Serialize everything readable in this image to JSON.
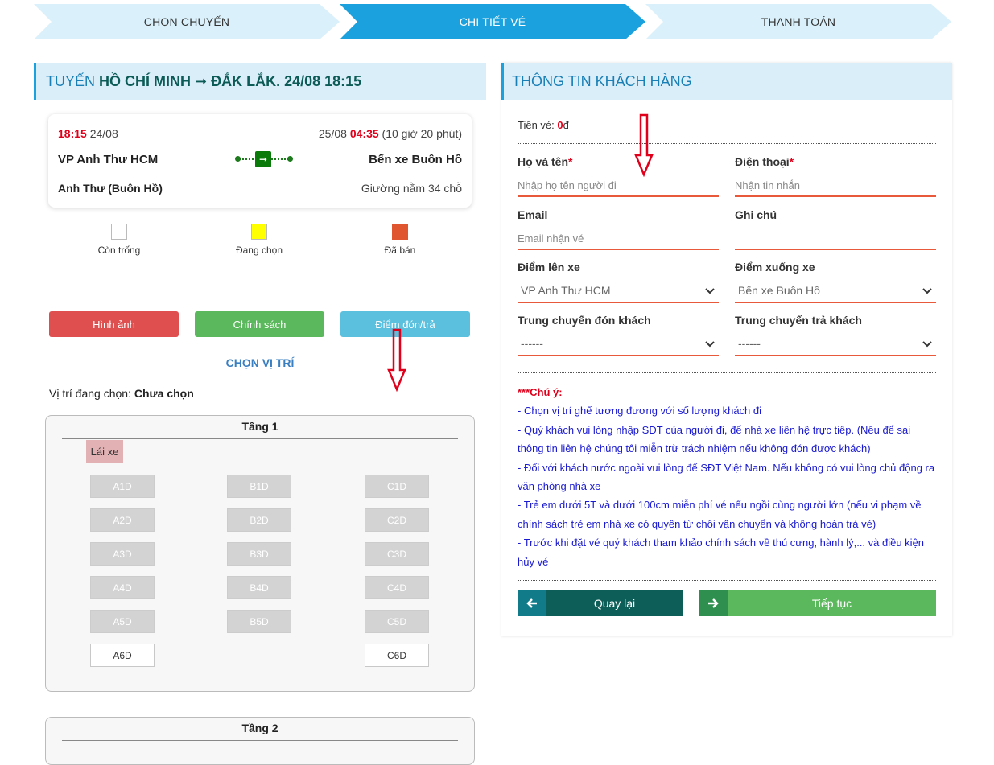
{
  "steps": [
    "CHỌN CHUYẾN",
    "CHI TIẾT VÉ",
    "THANH TOÁN"
  ],
  "route": {
    "prefix": "TUYẾN",
    "path": "HỒ CHÍ MINH ➞ ĐẮK LẮK",
    "datetime": ". 24/08 18:15"
  },
  "trip": {
    "dep_time": "18:15",
    "dep_date": "24/08",
    "arr_date": "25/08",
    "arr_time": "04:35",
    "duration": "(10 giờ 20 phút)",
    "from": "VP Anh Thư HCM",
    "to": "Bến xe Buôn Hồ",
    "operator": "Anh Thư (Buôn Hồ)",
    "vehicle": "Giường nằm 34 chỗ"
  },
  "legend": [
    {
      "label": "Còn trống",
      "color": "#ffffff"
    },
    {
      "label": "Đang chọn",
      "color": "#ffff00"
    },
    {
      "label": "Đã bán",
      "color": "#e0572f"
    }
  ],
  "buttons": {
    "images": "Hình ảnh",
    "policy": "Chính sách",
    "pickup": "Điểm đón/trả"
  },
  "choose_title": "CHỌN VỊ TRÍ",
  "current_position": {
    "label": "Vị trí đang chọn:",
    "value": "Chưa chọn"
  },
  "floors": [
    {
      "title": "Tầng 1",
      "driver": "Lái xe",
      "seats": [
        "A1D",
        "B1D",
        "C1D",
        "A2D",
        "B2D",
        "C2D",
        "A3D",
        "B3D",
        "C3D",
        "A4D",
        "B4D",
        "C4D",
        "A5D",
        "B5D",
        "C5D",
        "A6D",
        "C6D"
      ]
    },
    {
      "title": "Tầng 2"
    }
  ],
  "customer": {
    "title": "THÔNG TIN KHÁCH HÀNG",
    "price_label": "Tiền vé:",
    "price_value": "0",
    "price_unit": "đ",
    "name_label": "Họ và tên",
    "name_placeholder": "Nhập họ tên người đi",
    "phone_label": "Điện thoại",
    "phone_placeholder": "Nhận tin nhắn",
    "email_label": "Email",
    "email_placeholder": "Email nhận vé",
    "note_label": "Ghi chú",
    "board_label": "Điểm lên xe",
    "board_value": "VP Anh Thư HCM",
    "alight_label": "Điểm xuống xe",
    "alight_value": "Bến xe Buôn Hồ",
    "transfer_pick_label": "Trung chuyển đón khách",
    "transfer_pick_value": "------",
    "transfer_drop_label": "Trung chuyển trả khách",
    "transfer_drop_value": "------",
    "required_mark": "*"
  },
  "notice": {
    "title": "***Chú ý:",
    "lines": [
      "- Chọn vị trí ghế tương đương với số lượng khách đi",
      "- Quý khách vui lòng nhập SĐT của người đi, để nhà xe liên hệ trực tiếp. (Nếu để sai thông tin liên hệ chúng tôi miễn trừ trách nhiệm nếu không đón được khách)",
      "- Đối với khách nước ngoài vui lòng để SĐT Việt Nam. Nếu không có vui lòng chủ động ra văn phòng nhà xe",
      "- Trẻ em dưới 5T và dưới 100cm miễn phí vé nếu ngồi cùng người lớn (nếu vi phạm về chính sách trẻ em nhà xe có quyền từ chối vận chuyển và không hoàn trả vé)",
      "- Trước khi đặt vé quý khách tham khảo chính sách về thú cưng, hành lý,... và điều kiện hủy vé"
    ]
  },
  "nav": {
    "back": "Quay lại",
    "next": "Tiếp tục"
  },
  "colors": {
    "accent": "#1ba1dd",
    "sold": "#e0572f",
    "selected": "#ffff00"
  }
}
